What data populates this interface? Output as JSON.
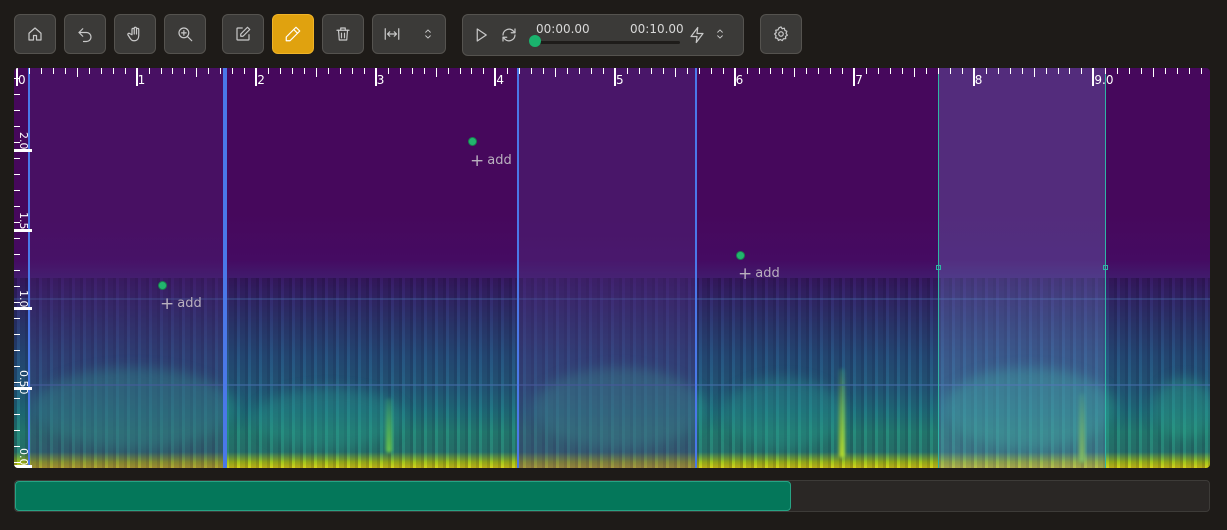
{
  "toolbar": {
    "buttons": [
      {
        "name": "home-button",
        "icon": "home-icon",
        "active": false
      },
      {
        "name": "undo-button",
        "icon": "undo-icon",
        "active": false
      },
      {
        "name": "pan-button",
        "icon": "hand-icon",
        "active": false
      },
      {
        "name": "zoom-button",
        "icon": "zoom-in-icon",
        "active": false
      },
      {
        "name": "edit-button",
        "icon": "edit-icon",
        "active": false
      },
      {
        "name": "draw-button",
        "icon": "pencil-icon",
        "active": true
      },
      {
        "name": "delete-button",
        "icon": "trash-icon",
        "active": false
      },
      {
        "name": "fit-width-button",
        "icon": "fit-width-icon",
        "active": false
      },
      {
        "name": "settings-button",
        "icon": "gear-icon",
        "active": false
      }
    ],
    "accent_color": "#e0a20f"
  },
  "player": {
    "current_time": "00:00.00",
    "duration": "00:10.00",
    "progress": 0
  },
  "spectrogram": {
    "x_ticks": [
      "0",
      "1",
      "2",
      "3",
      "4",
      "5",
      "6",
      "7",
      "8",
      "9.0"
    ],
    "y_ticks": [
      "2.0",
      "1.5",
      "1.0",
      "0.50",
      "0.0"
    ],
    "annotations": [
      {
        "label": "add"
      },
      {
        "label": "add"
      },
      {
        "label": "add"
      }
    ],
    "region_color": "#4a78e8",
    "selected_color": "#2fb5a4"
  },
  "scrollbar": {
    "visible_fraction": 0.65,
    "color": "#04775a"
  }
}
